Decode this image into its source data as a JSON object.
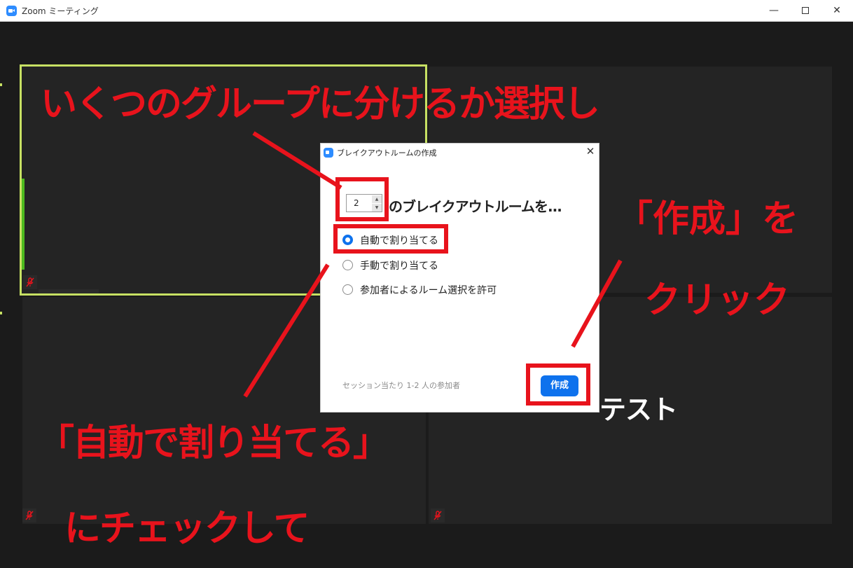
{
  "window": {
    "title": "Zoom ミーティング",
    "min_glyph": "—",
    "close_glyph": "✕"
  },
  "tiles": {
    "bottom_right_name": "テスト"
  },
  "dialog": {
    "title": "ブレイクアウトルームの作成",
    "close_glyph": "✕",
    "room_count": "2",
    "room_count_suffix": "のブレイクアウトルームを...",
    "options": [
      {
        "label": "自動で割り当てる",
        "checked": true
      },
      {
        "label": "手動で割り当てる",
        "checked": false
      },
      {
        "label": "参加者によるルーム選択を許可",
        "checked": false
      }
    ],
    "session_info": "セッション当たり 1-2 人の参加者",
    "create_label": "作成"
  },
  "annotations": {
    "choose_groups": "いくつのグループに分けるか選択し",
    "create_quote": "「作成」を",
    "click": "クリック",
    "auto_assign_quote": "「自動で割り当てる」",
    "check_it": "にチェックして"
  },
  "colors": {
    "accent": "#0e72ed",
    "annotation_red": "#e8131c",
    "active_speaker": "#c7e163",
    "zoom_blue": "#2d8cff"
  },
  "icons": [
    "zoom-app-icon",
    "minimize-icon",
    "maximize-icon",
    "close-icon",
    "microphone-muted-icon",
    "spinner-up-icon",
    "spinner-down-icon"
  ]
}
